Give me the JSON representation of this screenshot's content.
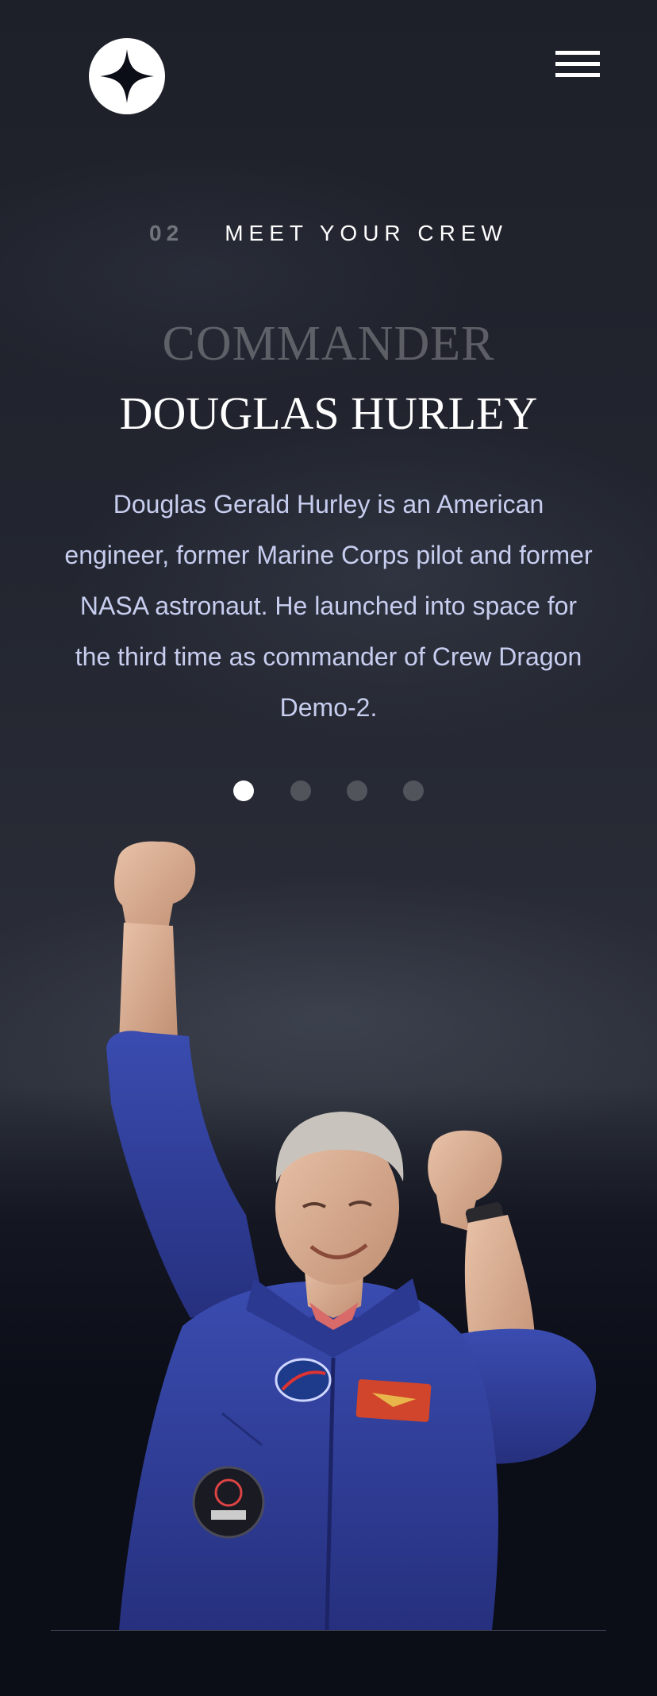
{
  "header": {
    "logo_icon": "four-point-star-logo-icon",
    "menu_icon": "hamburger-menu-icon"
  },
  "page_heading": {
    "number": "02",
    "title": "MEET YOUR CREW"
  },
  "crew": {
    "role": "COMMANDER",
    "name": "DOUGLAS HURLEY",
    "bio": "Douglas Gerald Hurley is an American engineer, former Marine Corps pilot and former NASA astronaut. He launched into space for the third time as commander of Crew Dragon Demo-2.",
    "image": "astronaut-portrait"
  },
  "pagination": {
    "count": 4,
    "active_index": 0
  },
  "colors": {
    "background": "#0b0d17",
    "text": "#ffffff",
    "body_text": "#d0d6f9",
    "suit_blue": "#2f3f9a"
  }
}
